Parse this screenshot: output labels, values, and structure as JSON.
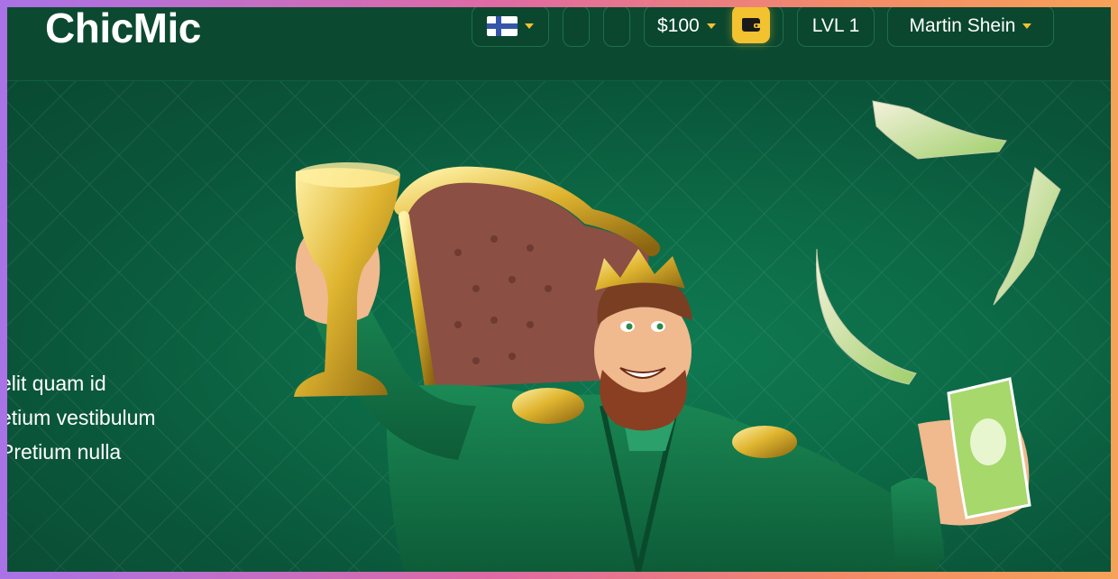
{
  "header": {
    "logo": "ChicMic",
    "language_flag": "finland-flag-icon",
    "balance": "$100",
    "level": "LVL 1",
    "user_name": "Martin Shein"
  },
  "hero": {
    "lines": [
      "elit quam id",
      "etium vestibulum",
      "Pretium nulla"
    ]
  },
  "colors": {
    "header_bg": "#0b4a30",
    "hero_bg": "#0c6a46",
    "accent_yellow": "#f2c230",
    "frame_gradient": [
      "#a972e6",
      "#f6a258"
    ]
  }
}
